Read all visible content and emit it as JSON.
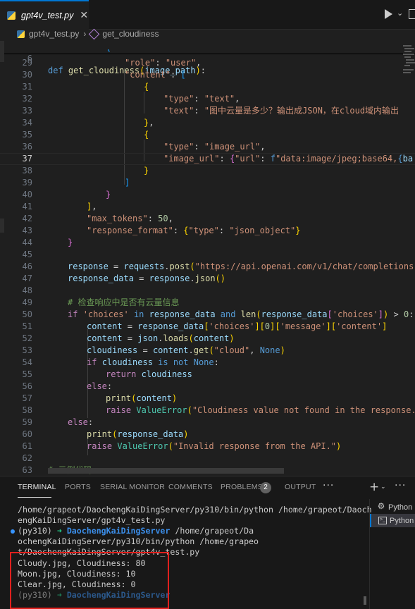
{
  "tab": {
    "label": "gpt4v_test.py",
    "close": "✕"
  },
  "breadcrumb": {
    "file": "gpt4v_test.py",
    "sep": "›",
    "symbol": "get_cloudiness"
  },
  "editor": {
    "sticky": {
      "number": "6",
      "def": "def",
      "name": "get_cloudiness",
      "args": "(image_path):"
    },
    "lines": [
      {
        "n": "29",
        "a": "\"role\"",
        "b": ": ",
        "c": "\"user\"",
        "d": ","
      },
      {
        "n": "30",
        "a": "\"content\"",
        "b": ": ",
        "c": "["
      },
      {
        "n": "31",
        "a": "{"
      },
      {
        "n": "32",
        "a": "\"type\"",
        "b": ": ",
        "c": "\"text\"",
        "d": ","
      },
      {
        "n": "33",
        "a": "\"text\"",
        "b": ": ",
        "c": "\"图中云量是多少？输出成JSON，在cloud域内输出"
      },
      {
        "n": "34",
        "a": "}",
        "b": ","
      },
      {
        "n": "35",
        "a": "{"
      },
      {
        "n": "36",
        "a": "\"type\"",
        "b": ": ",
        "c": "\"image_url\"",
        "d": ","
      },
      {
        "n": "37",
        "a": "\"image_url\"",
        "b": ": ",
        "c": "{",
        "d": "\"url\"",
        "e": ": ",
        "f": "f",
        "g": "\"data:image/jpeg;base64,",
        "h": "{",
        "i": "ba"
      },
      {
        "n": "38",
        "a": "}"
      },
      {
        "n": "39",
        "a": "]"
      },
      {
        "n": "40",
        "a": "}"
      },
      {
        "n": "41",
        "a": "]",
        "b": ","
      },
      {
        "n": "42",
        "a": "\"max_tokens\"",
        "b": ": ",
        "c": "50",
        "d": ","
      },
      {
        "n": "43",
        "a": "\"response_format\"",
        "b": ": ",
        "c": "{",
        "d": "\"type\"",
        "e": ": ",
        "f": "\"json_object\"",
        "g": "}"
      },
      {
        "n": "44",
        "a": "}"
      },
      {
        "n": "45"
      },
      {
        "n": "46",
        "a": "response",
        "b": " = ",
        "c": "requests",
        "d": ".",
        "e": "post",
        "f": "(",
        "g": "\"https://api.openai.com/v1/chat/completions\""
      },
      {
        "n": "47",
        "a": "response_data",
        "b": " = ",
        "c": "response",
        "d": ".",
        "e": "json",
        "f": "()"
      },
      {
        "n": "48"
      },
      {
        "n": "49",
        "a": "# 检查响应中是否有云量信息"
      },
      {
        "n": "50",
        "a": "if",
        "b": " ",
        "c": "'choices'",
        "d": " in ",
        "e": "response_data",
        "f": " and ",
        "g": "len",
        "h": "(",
        "i": "response_data",
        "j": "[",
        "k": "'choices'",
        "l": "]",
        "m": ")",
        "o": " > ",
        "p": "0",
        "q": ":"
      },
      {
        "n": "51",
        "a": "content",
        "b": " = ",
        "c": "response_data",
        "d": "[",
        "e": "'choices'",
        "f": "][",
        "g": "0",
        "h": "][",
        "i": "'message'",
        "j": "][",
        "k": "'content'",
        "l": "]"
      },
      {
        "n": "52",
        "a": "content",
        "b": " = ",
        "c": "json",
        "d": ".",
        "e": "loads",
        "f": "(",
        "g": "content",
        "h": ")"
      },
      {
        "n": "53",
        "a": "cloudiness",
        "b": " = ",
        "c": "content",
        "d": ".",
        "e": "get",
        "f": "(",
        "g": "\"cloud\"",
        "h": ", ",
        "i": "None",
        "j": ")"
      },
      {
        "n": "54",
        "a": "if",
        "b": " ",
        "c": "cloudiness",
        "d": " is not ",
        "e": "None",
        "f": ":"
      },
      {
        "n": "55",
        "a": "return",
        "b": " ",
        "c": "cloudiness"
      },
      {
        "n": "56",
        "a": "else",
        "b": ":"
      },
      {
        "n": "57",
        "a": "print",
        "b": "(",
        "c": "content",
        "d": ")"
      },
      {
        "n": "58",
        "a": "raise",
        "b": " ",
        "c": "ValueError",
        "d": "(",
        "e": "\"Cloudiness value not found in the response."
      },
      {
        "n": "59",
        "a": "else",
        "b": ":"
      },
      {
        "n": "60",
        "a": "print",
        "b": "(",
        "c": "response_data",
        "d": ")"
      },
      {
        "n": "61",
        "a": "raise",
        "b": " ",
        "c": "ValueError",
        "d": "(",
        "e": "\"Invalid response from the API.\"",
        "f": ")"
      },
      {
        "n": "62"
      },
      {
        "n": "63",
        "a": "# 示例代码"
      }
    ]
  },
  "panel": {
    "tabs": [
      "TERMINAL",
      "PORTS",
      "SERIAL MONITOR",
      "COMMENTS",
      "PROBLEMS",
      "OUTPUT"
    ],
    "problems_count": "2",
    "more": "···",
    "plus": "+",
    "plus_chev": "⌄",
    "more2": "···"
  },
  "terminal": {
    "l1": "/home/grapeot/DaochengKaiDingServer/py310/bin/python /home/grapeot/Daoch",
    "l2": "engKaiDingServer/gpt4v_test.py",
    "l3_env": "(py310) ",
    "l3_arrow": "➜ ",
    "l3_dir": "DaochengKaiDingServer",
    "l3_rest": " /home/grapeot/Da",
    "l4": "ochengKaiDingServer/py310/bin/python /home/grapeo",
    "l5": "t/DaochengKaiDingServer/gpt4v_test.py",
    "l6": "Cloudy.jpg, Cloudiness: 80",
    "l7": "Moon.jpg, Cloudiness: 10",
    "l8": "Clear.jpg, Cloudiness: 0",
    "l9_env": "(py310) ",
    "l9_arrow": "➜ ",
    "l9_dir": "DaochengKaiDingServer"
  },
  "terminal_sessions": [
    "Python",
    "Python"
  ],
  "colors": {
    "accent": "#0078d4",
    "highlight_box": "#e0201d",
    "prompt_arrow": "#23d18b",
    "prompt_dir": "#3b8eea"
  }
}
